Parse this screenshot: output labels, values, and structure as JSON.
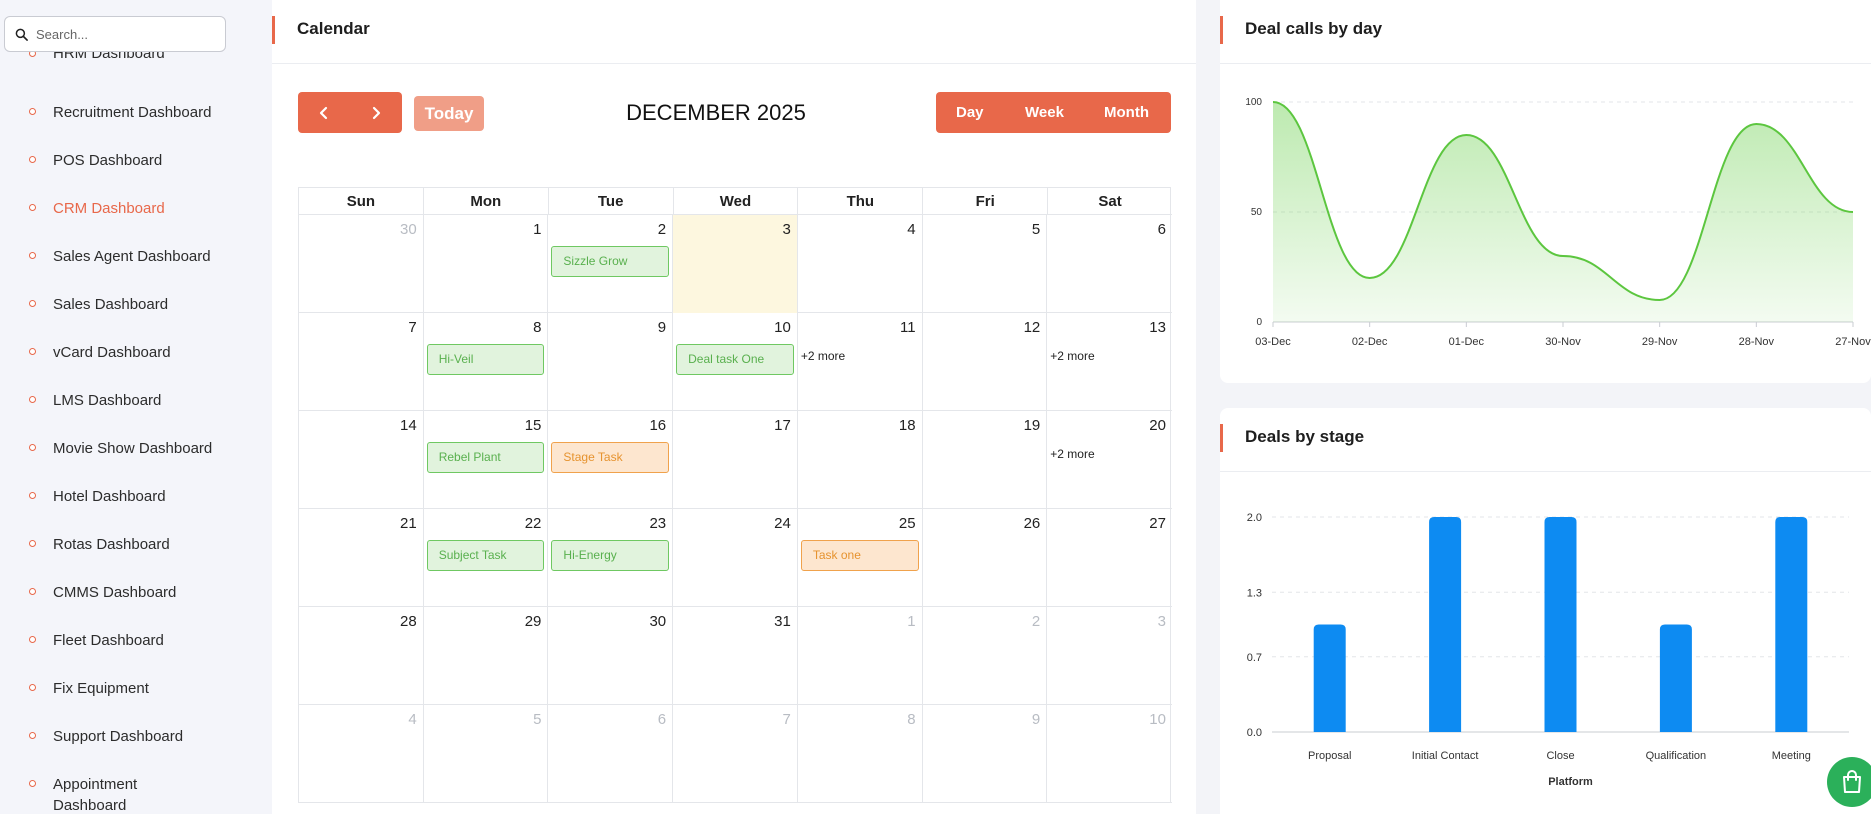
{
  "sidebar": {
    "search_placeholder": "Search...",
    "partial_item": "HRM Dashboard",
    "items": [
      {
        "label": "Recruitment Dashboard",
        "active": false
      },
      {
        "label": "POS Dashboard",
        "active": false
      },
      {
        "label": "CRM Dashboard",
        "active": true
      },
      {
        "label": "Sales Agent Dashboard",
        "active": false
      },
      {
        "label": "Sales Dashboard",
        "active": false
      },
      {
        "label": "vCard Dashboard",
        "active": false
      },
      {
        "label": "LMS Dashboard",
        "active": false
      },
      {
        "label": "Movie Show Dashboard",
        "active": false
      },
      {
        "label": "Hotel Dashboard",
        "active": false
      },
      {
        "label": "Rotas Dashboard",
        "active": false
      },
      {
        "label": "CMMS Dashboard",
        "active": false
      },
      {
        "label": "Fleet Dashboard",
        "active": false
      },
      {
        "label": "Fix Equipment",
        "active": false
      },
      {
        "label": "Support Dashboard",
        "active": false
      },
      {
        "label": "Appointment Dashboard",
        "active": false
      }
    ]
  },
  "calendar": {
    "title": "Calendar",
    "today_label": "Today",
    "month_label": "DECEMBER 2025",
    "views": [
      "Day",
      "Week",
      "Month"
    ],
    "weekdays": [
      "Sun",
      "Mon",
      "Tue",
      "Wed",
      "Thu",
      "Fri",
      "Sat"
    ],
    "weeks": [
      [
        {
          "d": "30",
          "m": true
        },
        {
          "d": "1"
        },
        {
          "d": "2",
          "event": {
            "label": "Sizzle Grow",
            "color": "green"
          }
        },
        {
          "d": "3",
          "today": true
        },
        {
          "d": "4"
        },
        {
          "d": "5"
        },
        {
          "d": "6"
        }
      ],
      [
        {
          "d": "7"
        },
        {
          "d": "8",
          "event": {
            "label": "Hi-Veil",
            "color": "green"
          }
        },
        {
          "d": "9"
        },
        {
          "d": "10",
          "event": {
            "label": "Deal task One",
            "color": "green"
          }
        },
        {
          "d": "11",
          "more": "+2 more"
        },
        {
          "d": "12"
        },
        {
          "d": "13",
          "more": "+2 more"
        }
      ],
      [
        {
          "d": "14"
        },
        {
          "d": "15",
          "event": {
            "label": "Rebel Plant",
            "color": "green"
          }
        },
        {
          "d": "16",
          "event": {
            "label": "Stage Task",
            "color": "orange"
          }
        },
        {
          "d": "17"
        },
        {
          "d": "18"
        },
        {
          "d": "19"
        },
        {
          "d": "20",
          "more": "+2 more"
        }
      ],
      [
        {
          "d": "21"
        },
        {
          "d": "22",
          "event": {
            "label": "Subject Task",
            "color": "green"
          }
        },
        {
          "d": "23",
          "event": {
            "label": "Hi-Energy",
            "color": "green"
          }
        },
        {
          "d": "24"
        },
        {
          "d": "25",
          "event": {
            "label": "Task one",
            "color": "orange"
          }
        },
        {
          "d": "26"
        },
        {
          "d": "27"
        }
      ],
      [
        {
          "d": "28"
        },
        {
          "d": "29"
        },
        {
          "d": "30"
        },
        {
          "d": "31"
        },
        {
          "d": "1",
          "m": true
        },
        {
          "d": "2",
          "m": true
        },
        {
          "d": "3",
          "m": true
        }
      ],
      [
        {
          "d": "4",
          "m": true
        },
        {
          "d": "5",
          "m": true
        },
        {
          "d": "6",
          "m": true
        },
        {
          "d": "7",
          "m": true
        },
        {
          "d": "8",
          "m": true
        },
        {
          "d": "9",
          "m": true
        },
        {
          "d": "10",
          "m": true
        }
      ]
    ]
  },
  "deal_calls": {
    "title": "Deal calls by day"
  },
  "deals_stage": {
    "title": "Deals by stage"
  },
  "chart_data": [
    {
      "type": "area",
      "title": "Deal calls by day",
      "categories": [
        "03-Dec",
        "02-Dec",
        "01-Dec",
        "30-Nov",
        "29-Nov",
        "28-Nov",
        "27-Nov"
      ],
      "values": [
        100,
        20,
        85,
        30,
        10,
        90,
        50
      ],
      "yticks": [
        "0",
        "50",
        "100"
      ],
      "ylim": [
        0,
        100
      ],
      "color": "#6cd04f",
      "grid": true
    },
    {
      "type": "bar",
      "title": "Deals by stage",
      "categories": [
        "Proposal",
        "Initial Contact",
        "Close",
        "Qualification",
        "Meeting"
      ],
      "values": [
        1,
        2,
        2,
        1,
        2
      ],
      "yticks": [
        "0.0",
        "0.7",
        "1.3",
        "2.0"
      ],
      "ylim": [
        0,
        2
      ],
      "xlabel": "Platform",
      "color": "#0d8bf2",
      "grid": true
    }
  ],
  "colors": {
    "accent": "#e8684a",
    "event_green": "#59b04e",
    "event_orange": "#e6932f",
    "cart": "#2bb05a"
  }
}
